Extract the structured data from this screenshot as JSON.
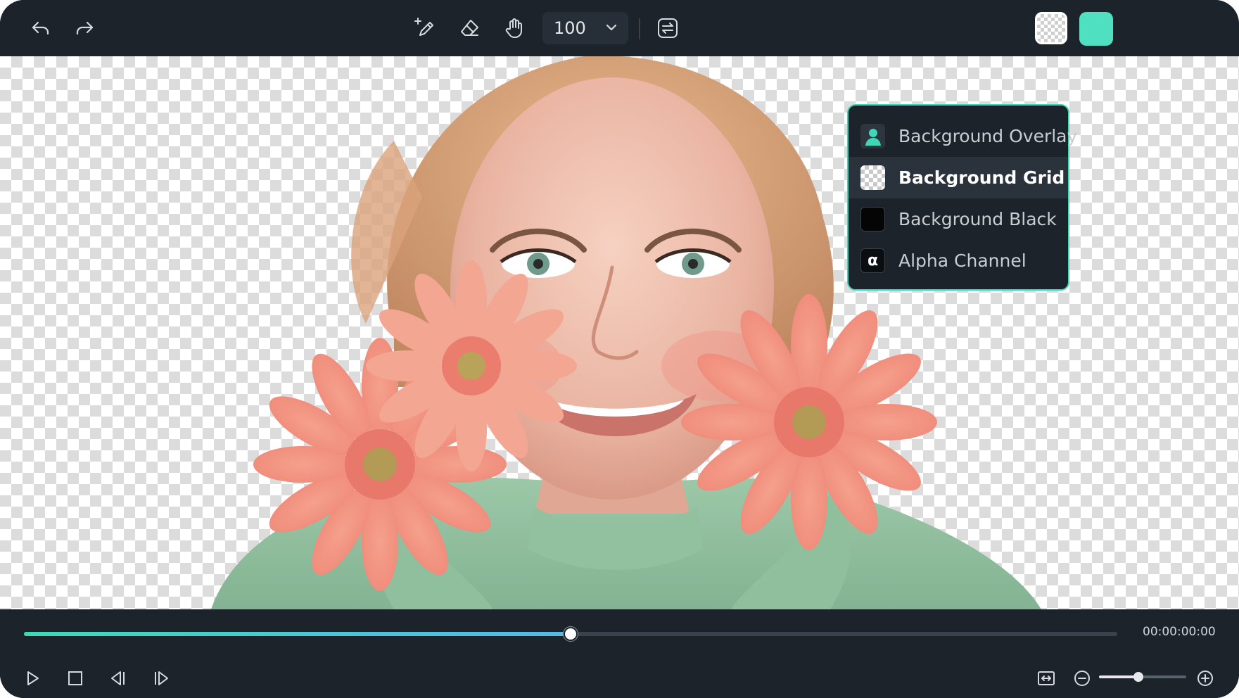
{
  "toolbar": {
    "undo_icon": "undo-icon",
    "redo_icon": "redo-icon",
    "smart_brush_icon": "magic-pen-icon",
    "eraser_icon": "eraser-icon",
    "hand_icon": "hand-icon",
    "zoom_value": "100",
    "swap_icon": "swap-icon",
    "background_color": "#4fe0c1"
  },
  "background_menu": {
    "items": [
      {
        "label": "Background Overlay",
        "icon": "person-overlay-icon",
        "selected": false
      },
      {
        "label": "Background Grid",
        "icon": "checker-grid-icon",
        "selected": true
      },
      {
        "label": "Background Black",
        "icon": "black-swatch-icon",
        "selected": false
      },
      {
        "label": "Alpha Channel",
        "icon": "alpha-icon",
        "icon_text": "α",
        "selected": false
      }
    ]
  },
  "playback": {
    "progress": 0.5,
    "timecode": "00:00:00:00",
    "zoom_level": 0.45
  },
  "colors": {
    "accent": "#3fd8b6",
    "toolbar_bg": "#1c232b"
  }
}
